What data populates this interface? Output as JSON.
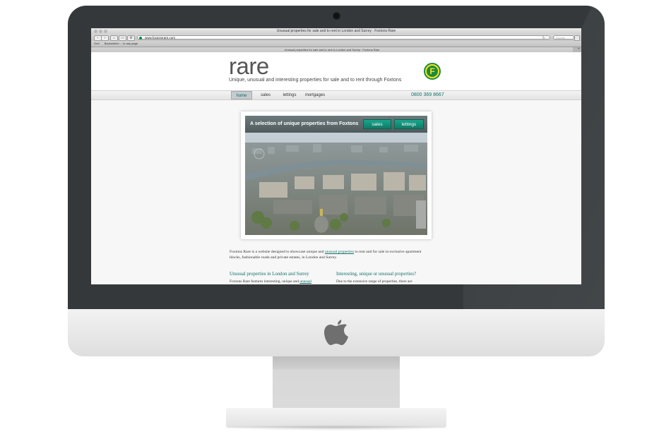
{
  "browser": {
    "window_title": "Unusual properties for sale and to rent in London and Surrey : Foxtons Rare",
    "url": "www.foxtonsrare.com",
    "search_placeholder": "Google",
    "bookmarks": [
      "Grid",
      "Backstretch ... to any page"
    ],
    "tab_title": "Unusual properties for sale and to rent in London and Surrey : Foxtons Rare",
    "icons": [
      "back-icon",
      "forward-icon",
      "home-icon",
      "share-icon",
      "reload-icon"
    ]
  },
  "site": {
    "logo": "rare",
    "tagline": "Unique, unusual and interesting properties for sale and to rent through Foxtons",
    "badge_letter": "F",
    "nav": {
      "home": "home",
      "sales": "sales",
      "lettings": "lettings",
      "mortgages": "mortgages",
      "active": "home"
    },
    "phone": "0800 369 8667",
    "hero": {
      "title": "A selection of unique properties from Foxtons",
      "sales_btn": "sales",
      "lettings_btn": "lettings"
    },
    "intro": {
      "part1": "Foxtons Rare is a website designed to showcase unique and ",
      "link": "unusual properties",
      "part2": " to rent and for sale in exclusive apartment blocks, fashionable roads and private estates, in London and Surrey."
    },
    "col1": {
      "heading": "Unusual properties in London and Surrey",
      "text": "Foxtons Rare features interesting, unique and ",
      "link": "unusual"
    },
    "col2": {
      "heading": "Interesting, unique or unusual properties?",
      "text": "Due to the extensive range of properties, there are"
    }
  },
  "colors": {
    "accent": "#0f6f69",
    "button": "#1aa68d",
    "badge_yellow": "#f2e51f",
    "badge_green": "#1d8a3d"
  }
}
